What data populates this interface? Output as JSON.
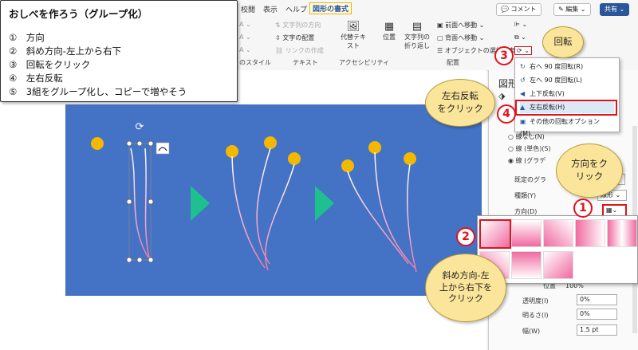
{
  "ribbon": {
    "tabs": [
      "校閲",
      "表示",
      "ヘルプ",
      "図形の書式"
    ],
    "active_tab": "図形の書式",
    "comment_btn": "コメント",
    "edit_btn": "編集",
    "share_btn": "共有",
    "text_direction": "文字列の方向",
    "text_align": "文字の配置",
    "create_link": "リンクの作成",
    "alt_text": "代替テキスト",
    "position": "位置",
    "wrap_text": "文字列の折り返し",
    "bring_forward": "前面へ移動",
    "send_backward": "背面へ移動",
    "selection_pane": "オブジェクトの選択と表示",
    "group_style": "のスタイル",
    "group_text": "テキスト",
    "group_access": "アクセシビリティ",
    "group_arrange": "配置"
  },
  "instructions": {
    "title": "おしべを作ろう（グループ化）",
    "steps": [
      "①　方向",
      "②　斜め方向-左上から右下",
      "③　回転をクリック",
      "④　左右反転",
      "⑤　3組をグループ化し、コピーで増やそう"
    ]
  },
  "rotate_menu": {
    "items": [
      {
        "label": "右へ 90 度回転(R)",
        "icon": "rotate-right-icon"
      },
      {
        "label": "左へ 90 度回転(L)",
        "icon": "rotate-left-icon"
      },
      {
        "label": "上下反転(V)",
        "icon": "flip-vertical-icon"
      },
      {
        "label": "左右反転(H)",
        "icon": "flip-horizontal-icon"
      },
      {
        "label": "その他の回転オプション(M)...",
        "icon": "rotate-options-icon"
      }
    ],
    "highlighted": "左右反転(H)"
  },
  "format_pane": {
    "title": "図形",
    "line_none": "線なし(N)",
    "line_solid": "線 (単色)(S)",
    "line_gradient": "線 (グラデ",
    "preset_gradient": "既定のグラ",
    "type_label": "種類(Y)",
    "type_value": "線形",
    "direction_label": "方向(D)",
    "position_label": "位置",
    "position_value": "100%",
    "transparency_label": "透明度(I)",
    "transparency_value": "0%",
    "brightness_label": "明るさ(I)",
    "brightness_value": "0%",
    "width_label": "幅(W)",
    "width_value": "1.5 pt"
  },
  "callouts": {
    "rotate": "回転",
    "flip": "左右反転\nをクリック",
    "direction": "方向をク\nリック",
    "diagonal": "斜め方向-左\n上から右下を\nクリック",
    "num1": "1",
    "num2": "2",
    "num3": "3",
    "num4": "4"
  },
  "colors": {
    "slide": "#4472c4",
    "pollen": "#f5b800",
    "arrow": "#1fc08f",
    "accent_red": "#e0121c",
    "bubble": "#fbe59a"
  }
}
